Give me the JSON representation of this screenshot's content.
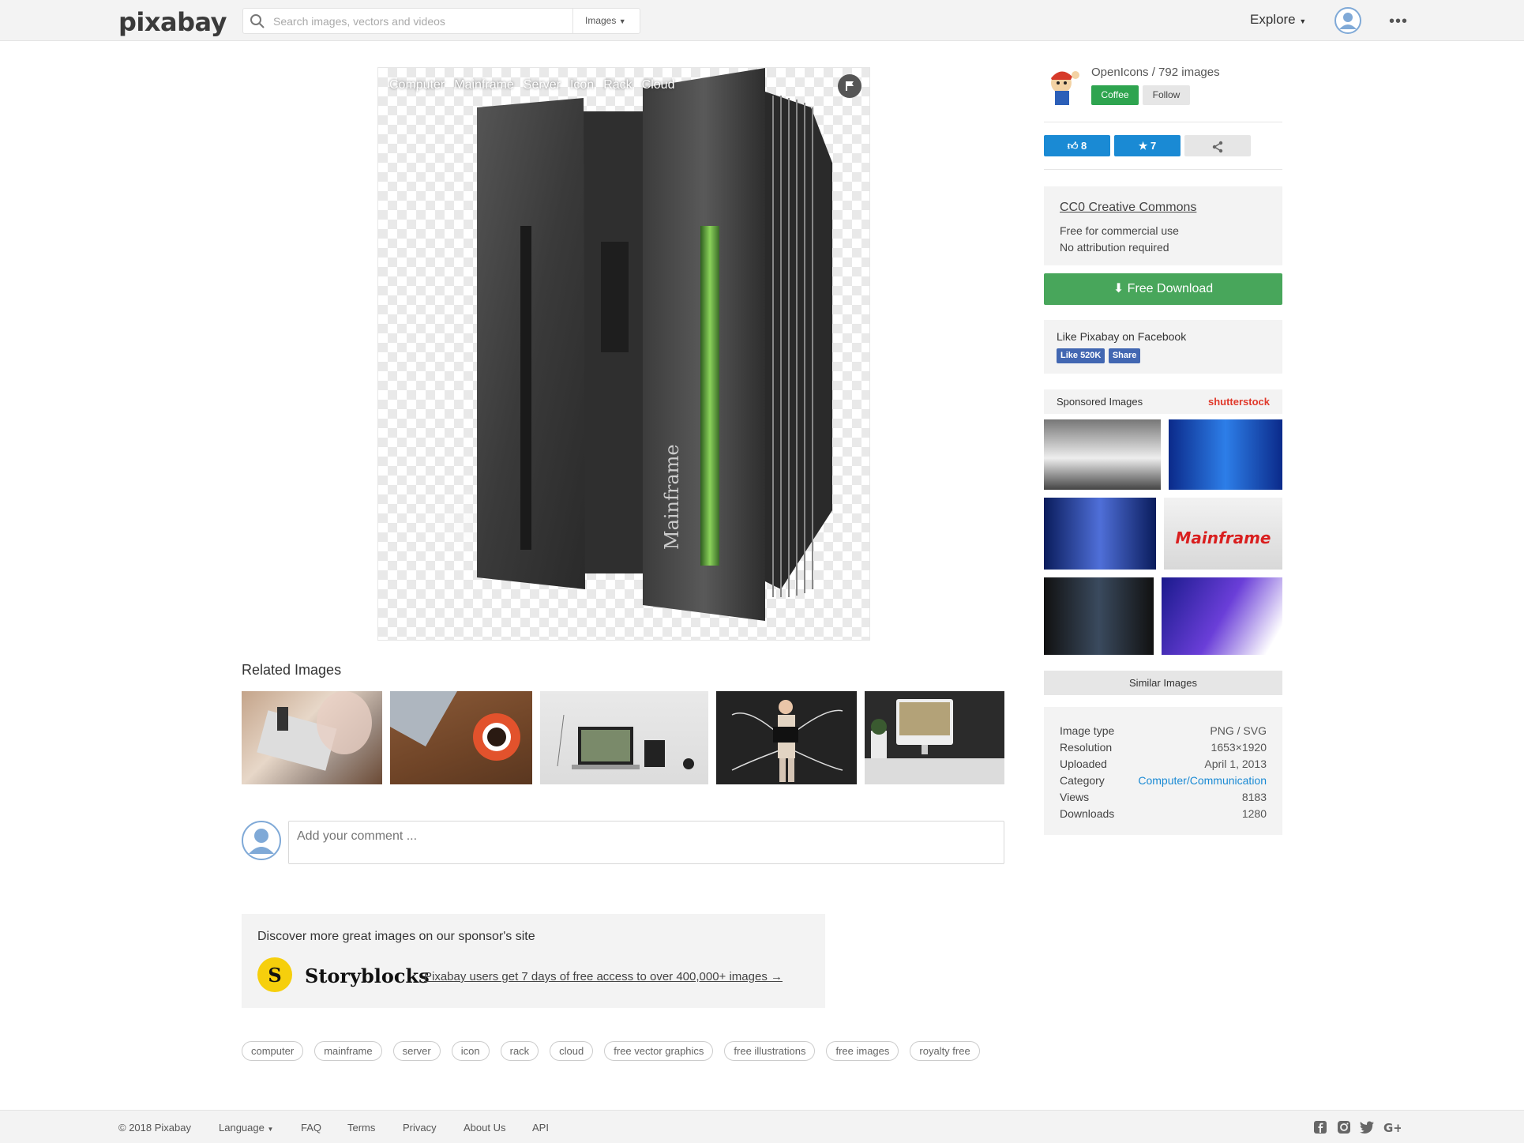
{
  "header": {
    "logo": "pixabay",
    "search_placeholder": "Search images, vectors and videos",
    "search_type": "Images",
    "explore": "Explore",
    "more": "•••"
  },
  "main_image": {
    "tags": [
      "Computer",
      "Mainframe",
      "Server",
      "Icon",
      "Rack",
      "Cloud"
    ],
    "side_text": "Mainframe"
  },
  "related": {
    "title": "Related Images"
  },
  "comment": {
    "placeholder": "Add your comment ..."
  },
  "sponsor": {
    "title": "Discover more great images on our sponsor's site",
    "brand": "Storyblocks",
    "link": "Pixabay users get 7 days of free access to over 400,000+ images →"
  },
  "tags": [
    "computer",
    "mainframe",
    "server",
    "icon",
    "rack",
    "cloud",
    "free vector graphics",
    "free illustrations",
    "free images",
    "royalty free"
  ],
  "footer": {
    "copyright": "© 2018 Pixabay",
    "language": "Language",
    "links": [
      "FAQ",
      "Terms",
      "Privacy",
      "About Us",
      "API"
    ]
  },
  "sidebar": {
    "author": "OpenIcons / 792 images",
    "coffee": "Coffee",
    "follow": "Follow",
    "likes": "8",
    "favorites": "7",
    "license_title": "CC0 Creative Commons",
    "license_lines": [
      "Free for commercial use",
      "No attribution required"
    ],
    "download": "Free Download",
    "fb_title": "Like Pixabay on Facebook",
    "fb_like": "Like 520K",
    "fb_share": "Share",
    "sponsored": "Sponsored Images",
    "shutterstock": "shutterstock",
    "similar": "Similar Images",
    "info": [
      {
        "label": "Image type",
        "value": "PNG / SVG"
      },
      {
        "label": "Resolution",
        "value": "1653×1920"
      },
      {
        "label": "Uploaded",
        "value": "April 1, 2013"
      },
      {
        "label": "Category",
        "value": "Computer/Communication"
      },
      {
        "label": "Views",
        "value": "8183"
      },
      {
        "label": "Downloads",
        "value": "1280"
      }
    ]
  },
  "colors": {
    "green": "#48a65b",
    "blue": "#1a8ad4",
    "link": "#1a8ad4"
  }
}
